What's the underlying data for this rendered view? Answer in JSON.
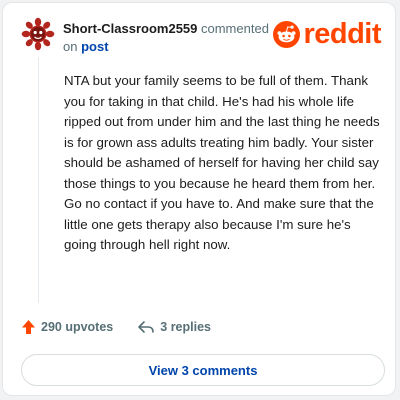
{
  "comment": {
    "username": "Short-Classroom2559",
    "action_text": " commented",
    "preposition": "on ",
    "post_link": "post",
    "body": "NTA but your family seems to be full of them. Thank you for taking in that child. He's had his whole life ripped out from under him and the last thing he needs is for grown ass adults treating him badly. Your sister should be ashamed of herself for having her child say those things to you because he heard them from her. Go no contact if you have to. And make sure that the little one gets therapy also because I'm sure he's going through hell right now.",
    "upvotes_label": "290 upvotes",
    "replies_label": "3 replies",
    "view_comments_label": "View 3 comments"
  },
  "brand": {
    "wordmark": "reddit",
    "icon": "reddit-snoo-icon"
  },
  "colors": {
    "brand_orange": "#ff4500",
    "link_blue": "#0045ac",
    "meta_gray": "#576f76",
    "text": "#1c1c1c",
    "avatar_red": "#b3261e"
  }
}
